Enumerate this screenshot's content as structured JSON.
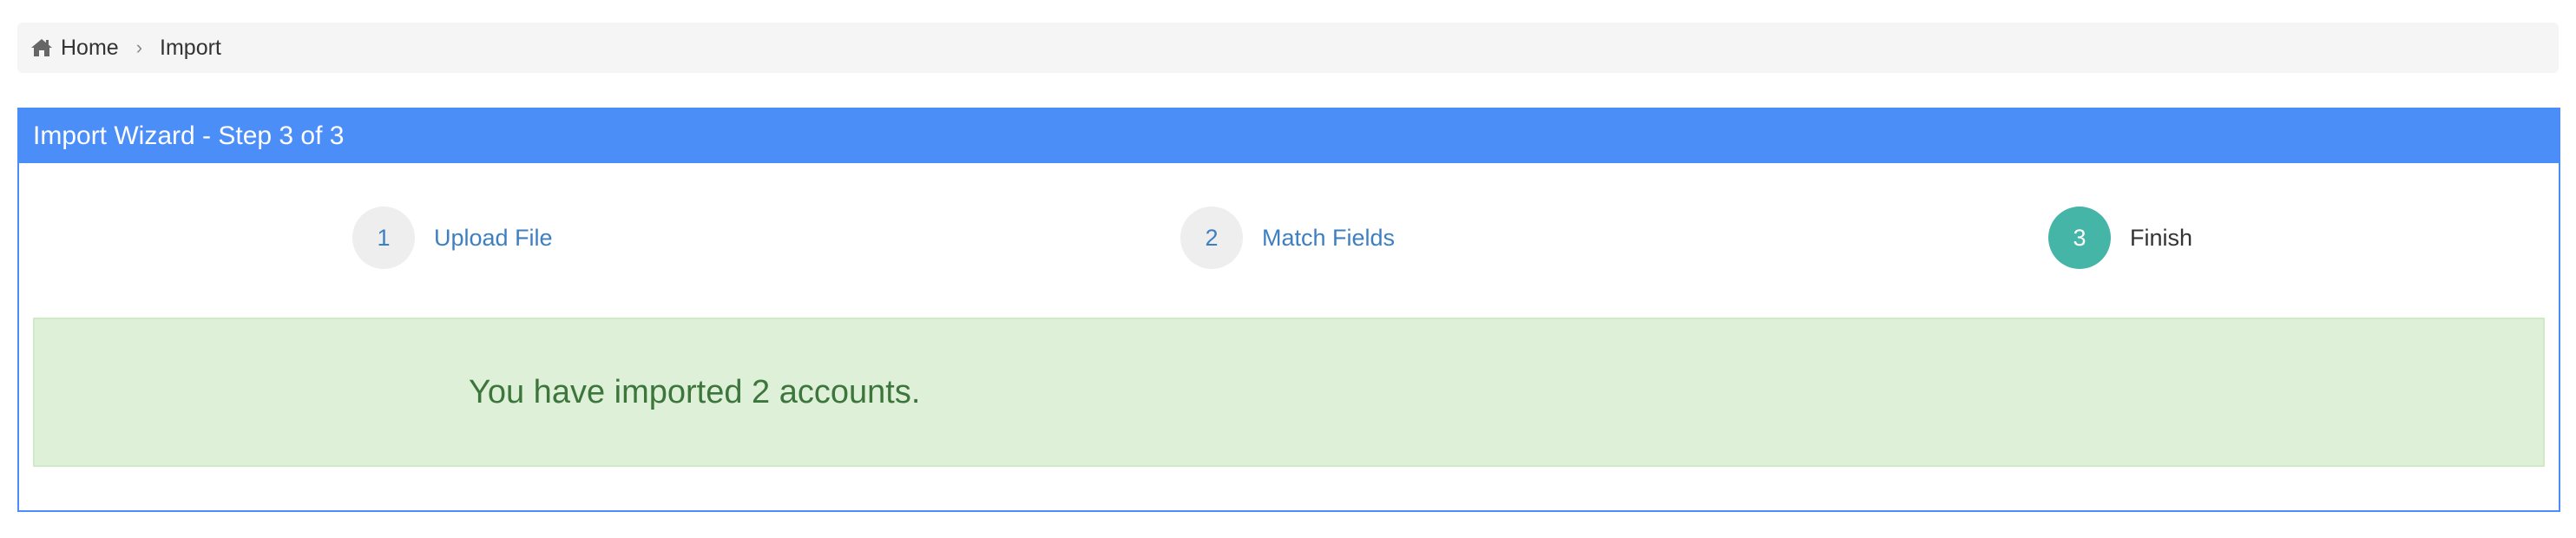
{
  "breadcrumb": {
    "home_icon": "home-icon",
    "items": [
      {
        "label": "Home"
      },
      {
        "label": "Import"
      }
    ],
    "separator": "›"
  },
  "panel": {
    "title": "Import Wizard - Step 3 of 3",
    "accent_color": "#4b8ef8"
  },
  "steps": [
    {
      "number": "1",
      "label": "Upload File",
      "state": "done"
    },
    {
      "number": "2",
      "label": "Match Fields",
      "state": "done"
    },
    {
      "number": "3",
      "label": "Finish",
      "state": "active"
    }
  ],
  "result": {
    "message": "You have imported 2 accounts.",
    "status_color": "#3c763d"
  }
}
